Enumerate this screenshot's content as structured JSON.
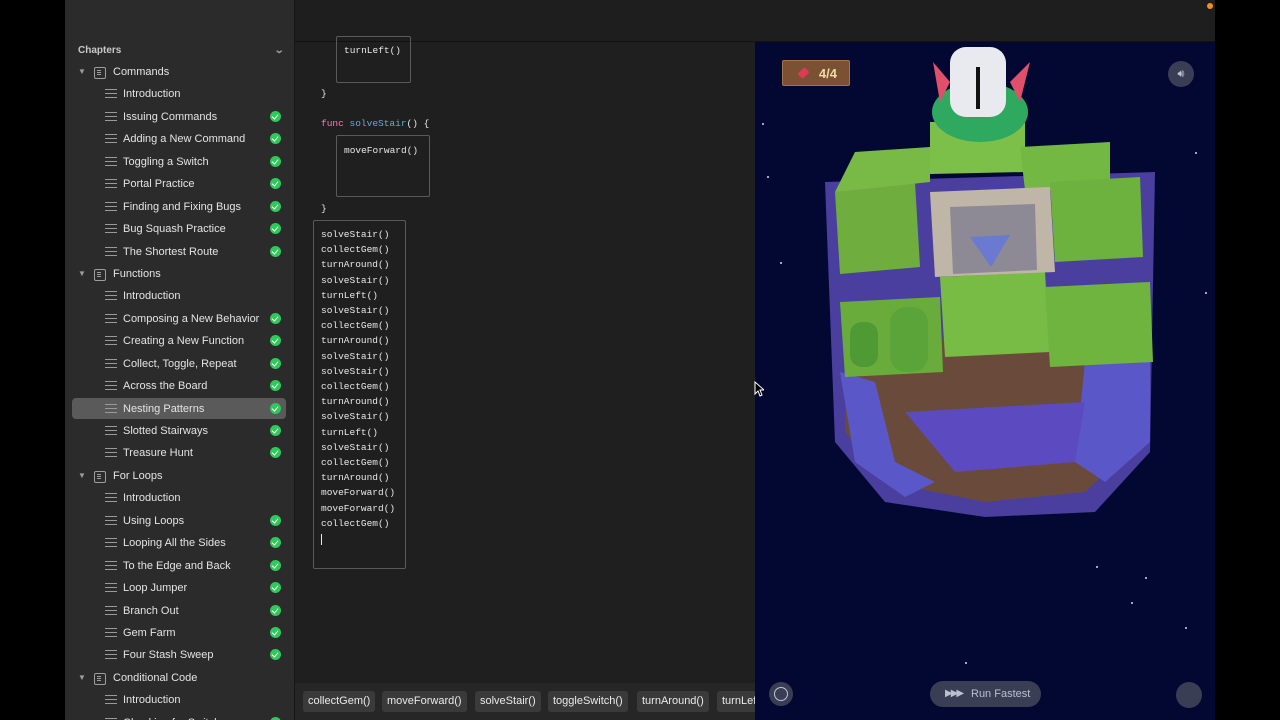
{
  "sidebar": {
    "header": "Chapters",
    "rows": [
      {
        "type": "chapter",
        "label": "Commands",
        "done": false
      },
      {
        "type": "page",
        "label": "Introduction",
        "done": false
      },
      {
        "type": "page",
        "label": "Issuing Commands",
        "done": true
      },
      {
        "type": "page",
        "label": "Adding a New Command",
        "done": true
      },
      {
        "type": "page",
        "label": "Toggling a Switch",
        "done": true
      },
      {
        "type": "page",
        "label": "Portal Practice",
        "done": true
      },
      {
        "type": "page",
        "label": "Finding and Fixing Bugs",
        "done": true
      },
      {
        "type": "page",
        "label": "Bug Squash Practice",
        "done": true
      },
      {
        "type": "page",
        "label": "The Shortest Route",
        "done": true
      },
      {
        "type": "chapter",
        "label": "Functions",
        "done": false
      },
      {
        "type": "page",
        "label": "Introduction",
        "done": false
      },
      {
        "type": "page",
        "label": "Composing a New Behavior",
        "done": true
      },
      {
        "type": "page",
        "label": "Creating a New Function",
        "done": true
      },
      {
        "type": "page",
        "label": "Collect, Toggle, Repeat",
        "done": true
      },
      {
        "type": "page",
        "label": "Across the Board",
        "done": true
      },
      {
        "type": "page",
        "label": "Nesting Patterns",
        "done": true,
        "selected": true
      },
      {
        "type": "page",
        "label": "Slotted Stairways",
        "done": true
      },
      {
        "type": "page",
        "label": "Treasure Hunt",
        "done": true
      },
      {
        "type": "chapter",
        "label": "For Loops",
        "done": false
      },
      {
        "type": "page",
        "label": "Introduction",
        "done": false
      },
      {
        "type": "page",
        "label": "Using Loops",
        "done": true
      },
      {
        "type": "page",
        "label": "Looping All the Sides",
        "done": true
      },
      {
        "type": "page",
        "label": "To the Edge and Back",
        "done": true
      },
      {
        "type": "page",
        "label": "Loop Jumper",
        "done": true
      },
      {
        "type": "page",
        "label": "Branch Out",
        "done": true
      },
      {
        "type": "page",
        "label": "Gem Farm",
        "done": true
      },
      {
        "type": "page",
        "label": "Four Stash Sweep",
        "done": true
      },
      {
        "type": "chapter",
        "label": "Conditional Code",
        "done": false
      },
      {
        "type": "page",
        "label": "Introduction",
        "done": false
      },
      {
        "type": "page",
        "label": "Checking for Switches",
        "done": true
      }
    ]
  },
  "editor": {
    "func1_body": "turnLeft()",
    "closing_brace": "}",
    "func2_keyword": "func",
    "func2_name": "solveStair",
    "func2_rest": "() {",
    "func2_body": "moveForward()",
    "main_code": [
      "solveStair()",
      "collectGem()",
      "turnAround()",
      "solveStair()",
      "turnLeft()",
      "solveStair()",
      "collectGem()",
      "turnAround()",
      "solveStair()",
      "solveStair()",
      "collectGem()",
      "turnAround()",
      "solveStair()",
      "turnLeft()",
      "solveStair()",
      "collectGem()",
      "turnAround()",
      "moveForward()",
      "moveForward()",
      "collectGem()"
    ]
  },
  "shortcuts": [
    "collectGem()",
    "moveForward()",
    "solveStair()",
    "toggleSwitch()",
    "turnAround()",
    "turnLeft()"
  ],
  "scene": {
    "gem_count": "4/4",
    "run_label": "Run Fastest"
  },
  "colors": {
    "keyword": "#ff7ab2",
    "function_name": "#5ab0d6",
    "check": "#2ec95a",
    "scene_bg": "#030833"
  }
}
